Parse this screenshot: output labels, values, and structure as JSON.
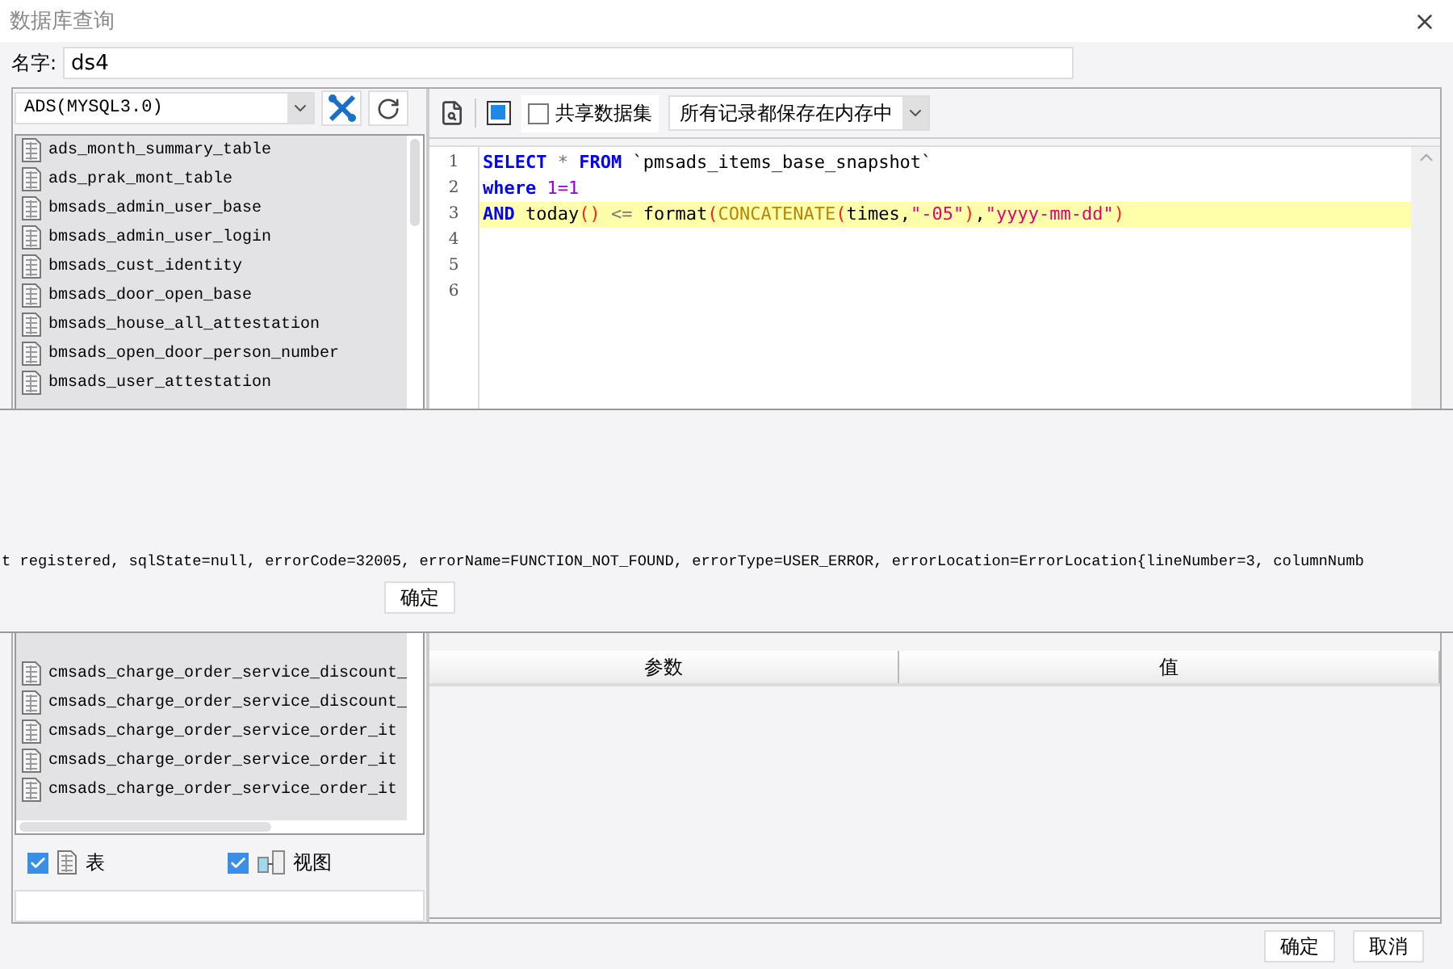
{
  "window": {
    "title": "数据库查询"
  },
  "name_field": {
    "label": "名字:",
    "value": "ds4"
  },
  "connection": {
    "value": "ADS(MYSQL3.0)"
  },
  "tables_top": [
    "ads_month_summary_table",
    "ads_prak_mont_table",
    "bmsads_admin_user_base",
    "bmsads_admin_user_login",
    "bmsads_cust_identity",
    "bmsads_door_open_base",
    "bmsads_house_all_attestation",
    "bmsads_open_door_person_number",
    "bmsads_user_attestation"
  ],
  "tables_bottom": [
    "cmsads_charge_order_service_discount_",
    "cmsads_charge_order_service_discount_",
    "cmsads_charge_order_service_order_it",
    "cmsads_charge_order_service_order_it",
    "cmsads_charge_order_service_order_it"
  ],
  "filters": [
    {
      "label": "表",
      "kind": "table",
      "checked": true
    },
    {
      "label": "视图",
      "kind": "view",
      "checked": true
    }
  ],
  "toolbar": {
    "share": {
      "label": "共享数据集",
      "checked": false
    },
    "storage": {
      "value": "所有记录都保存在内存中"
    }
  },
  "editor": {
    "lines": [
      {
        "number": "1",
        "highlighted": false,
        "tokens": [
          {
            "kind": "keyword",
            "text": "SELECT"
          },
          {
            "kind": "operator",
            "text": " * "
          },
          {
            "kind": "keyword",
            "text": "FROM"
          },
          {
            "kind": "plain",
            "text": " `pmsads_items_base_snapshot`"
          }
        ]
      },
      {
        "number": "2",
        "highlighted": false,
        "tokens": [
          {
            "kind": "keyword",
            "text": "where"
          },
          {
            "kind": "number",
            "text": " 1=1"
          }
        ]
      },
      {
        "number": "3",
        "highlighted": true,
        "tokens": [
          {
            "kind": "keyword",
            "text": "AND"
          },
          {
            "kind": "plain",
            "text": " today"
          },
          {
            "kind": "paren",
            "text": "()"
          },
          {
            "kind": "operator",
            "text": " <= "
          },
          {
            "kind": "plain",
            "text": "format"
          },
          {
            "kind": "paren",
            "text": "("
          },
          {
            "kind": "function",
            "text": "CONCATENATE"
          },
          {
            "kind": "paren",
            "text": "("
          },
          {
            "kind": "plain",
            "text": "times,"
          },
          {
            "kind": "string",
            "text": "\"-05\""
          },
          {
            "kind": "paren",
            "text": ")"
          },
          {
            "kind": "plain",
            "text": ","
          },
          {
            "kind": "string",
            "text": "\"yyyy-mm-dd\""
          },
          {
            "kind": "paren",
            "text": ")"
          }
        ]
      },
      {
        "number": "4",
        "highlighted": false
      },
      {
        "number": "5",
        "highlighted": false
      },
      {
        "number": "6",
        "highlighted": false
      }
    ]
  },
  "parameters": {
    "columns": [
      "参数",
      "值"
    ]
  },
  "error_dialog": {
    "message": "t registered, sqlState=null, errorCode=32005, errorName=FUNCTION_NOT_FOUND, errorType=USER_ERROR, errorLocation=ErrorLocation{lineNumber=3, columnNumb",
    "button": "确定"
  },
  "buttons": [
    {
      "label": "确定"
    },
    {
      "label": "取消"
    }
  ]
}
